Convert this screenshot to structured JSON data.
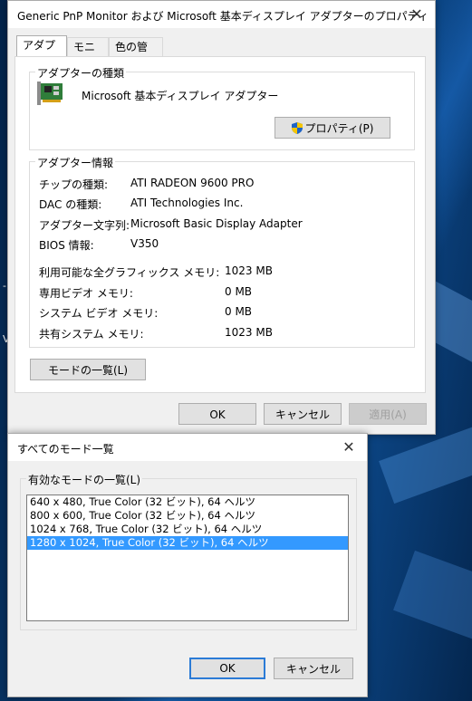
{
  "props_window": {
    "title": "Generic PnP Monitor および Microsoft 基本ディスプレイ アダプターのプロパティ",
    "tabs": [
      {
        "label": "アダプター"
      },
      {
        "label": "モニター"
      },
      {
        "label": "色の管理"
      }
    ],
    "adapter_type": {
      "legend": "アダプターの種類",
      "name": "Microsoft 基本ディスプレイ アダプター",
      "properties_button": "プロパティ(P)"
    },
    "adapter_info": {
      "legend": "アダプター情報",
      "rows": [
        {
          "label": "チップの種類:",
          "value": "ATI RADEON 9600 PRO"
        },
        {
          "label": "DAC の種類:",
          "value": "ATI Technologies Inc."
        },
        {
          "label": "アダプター文字列:",
          "value": "Microsoft Basic Display Adapter"
        },
        {
          "label": "BIOS 情報:",
          "value": "V350"
        }
      ],
      "memory": [
        {
          "label": "利用可能な全グラフィックス メモリ:",
          "value": "1023 MB"
        },
        {
          "label": "専用ビデオ メモリ:",
          "value": "0 MB"
        },
        {
          "label": "システム ビデオ メモリ:",
          "value": "0 MB"
        },
        {
          "label": "共有システム メモリ:",
          "value": "1023 MB"
        }
      ]
    },
    "list_modes_button": "モードの一覧(L)",
    "ok": "OK",
    "cancel": "キャンセル",
    "apply": "適用(A)"
  },
  "modes_window": {
    "title": "すべてのモード一覧",
    "legend": "有効なモードの一覧(L)",
    "modes": [
      "640 x 480, True Color (32 ビット), 64 ヘルツ",
      "800 x 600, True Color (32 ビット), 64 ヘルツ",
      "1024 x 768, True Color (32 ビット), 64 ヘルツ",
      "1280 x 1024, True Color (32 ビット), 64 ヘルツ"
    ],
    "selected_index": 3,
    "ok": "OK",
    "cancel": "キャンセル"
  },
  "desktop_partial_text": [
    "-",
    "V"
  ]
}
